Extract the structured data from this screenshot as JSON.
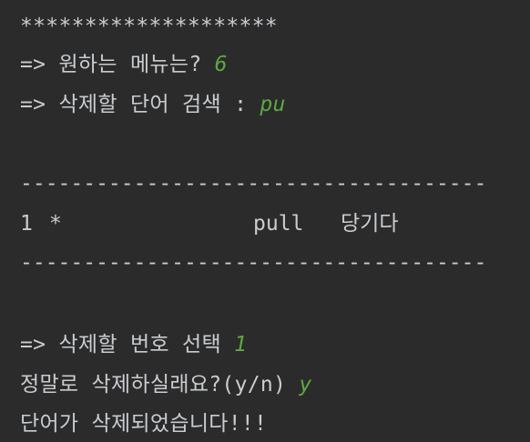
{
  "console": {
    "stars": "********************",
    "menu_prompt": "=> 원하는 메뉴는? ",
    "menu_input": "6",
    "search_prompt": "=> 삭제할 단어 검색 : ",
    "search_input": "pu",
    "rule_top": "-------------------------------------",
    "result_row": {
      "index": "1",
      "marker": "*",
      "word": "pull",
      "meaning": "당기다"
    },
    "rule_bottom": "-------------------------------------",
    "select_prompt": "=> 삭제할 번호 선택 ",
    "select_input": "1",
    "confirm_prompt": "정말로 삭제하실래요?(y/n) ",
    "confirm_input": "y",
    "done_message": "단어가 삭제되었습니다!!!"
  }
}
